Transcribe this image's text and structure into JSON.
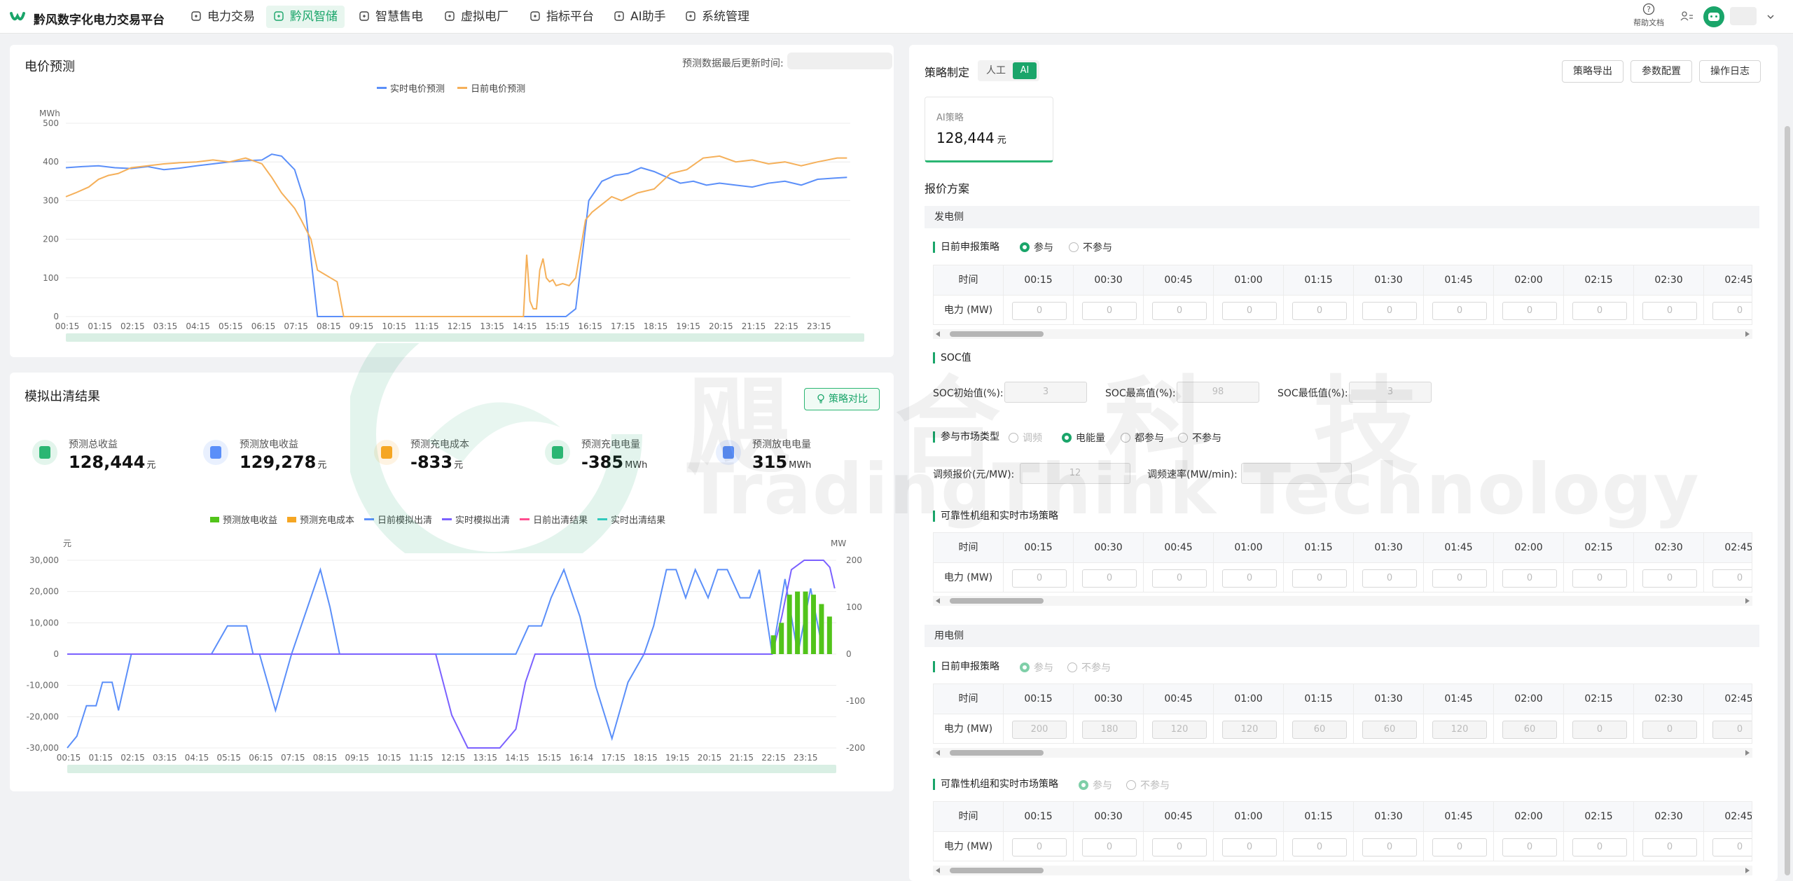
{
  "nav": {
    "brand": "黔风数字化电力交易平台",
    "items": [
      "电力交易",
      "黔风智储",
      "智慧售电",
      "虚拟电厂",
      "指标平台",
      "AI助手",
      "系统管理"
    ],
    "active_index": 1,
    "help_label": "帮助文档"
  },
  "forecast": {
    "title": "电价预测",
    "update_label": "预测数据最后更新时间:",
    "legend": [
      "实时电价预测",
      "日前电价预测"
    ],
    "chart_data": {
      "type": "line",
      "ylabel": "MWh",
      "ylim": [
        0,
        500
      ],
      "yticks": [
        0,
        100,
        200,
        300,
        400,
        500
      ],
      "x_ticks": [
        "00:15",
        "01:15",
        "02:15",
        "03:15",
        "04:15",
        "05:15",
        "06:15",
        "07:15",
        "08:15",
        "09:15",
        "10:15",
        "11:15",
        "12:15",
        "13:15",
        "14:15",
        "15:15",
        "16:15",
        "17:15",
        "18:15",
        "19:15",
        "20:15",
        "21:15",
        "22:15",
        "23:15"
      ],
      "series": [
        {
          "name": "实时电价预测",
          "color": "#5b8ff9",
          "x": [
            0,
            0.5,
            1,
            1.5,
            2,
            2.5,
            3,
            3.5,
            4,
            4.5,
            5,
            5.5,
            6,
            6.3,
            6.6,
            7,
            7.3,
            7.5,
            7.7,
            7.9,
            8.2,
            9,
            10,
            12,
            14,
            14.5,
            15,
            15.3,
            15.6,
            16,
            16.4,
            16.8,
            17.2,
            17.6,
            18,
            18.4,
            18.8,
            19.2,
            19.6,
            20,
            20.5,
            21,
            21.5,
            22,
            22.5,
            23,
            23.5,
            23.9
          ],
          "values": [
            385,
            388,
            390,
            385,
            383,
            388,
            380,
            384,
            390,
            395,
            400,
            403,
            405,
            420,
            415,
            380,
            300,
            150,
            0,
            0,
            0,
            0,
            0,
            0,
            0,
            0,
            0,
            0,
            20,
            300,
            350,
            365,
            370,
            385,
            375,
            360,
            345,
            350,
            340,
            345,
            340,
            335,
            345,
            350,
            340,
            355,
            358,
            360
          ]
        },
        {
          "name": "日前电价预测",
          "color": "#f5b05a",
          "x": [
            0,
            0.3,
            0.7,
            1,
            1.3,
            1.6,
            2,
            2.5,
            3,
            3.5,
            4,
            4.5,
            5,
            5.5,
            6,
            6.3,
            6.6,
            7,
            7.2,
            7.5,
            7.7,
            7.9,
            8.1,
            8.3,
            8.5,
            9,
            10,
            12,
            14,
            14.1,
            14.2,
            14.3,
            14.4,
            14.5,
            14.6,
            14.7,
            14.8,
            14.9,
            15,
            15.2,
            15.4,
            15.6,
            15.9,
            16.1,
            16.4,
            16.7,
            17,
            17.5,
            18,
            18.5,
            19,
            19.5,
            20,
            20.5,
            21,
            21.5,
            22,
            22.5,
            23,
            23.3,
            23.6,
            23.9
          ],
          "values": [
            310,
            320,
            335,
            355,
            365,
            370,
            385,
            390,
            395,
            398,
            400,
            405,
            400,
            410,
            395,
            360,
            320,
            280,
            250,
            200,
            120,
            110,
            100,
            90,
            0,
            0,
            0,
            0,
            0,
            160,
            40,
            20,
            20,
            120,
            150,
            100,
            90,
            95,
            80,
            85,
            80,
            100,
            250,
            270,
            290,
            310,
            300,
            320,
            330,
            370,
            380,
            410,
            415,
            400,
            405,
            395,
            400,
            390,
            400,
            405,
            410,
            410
          ]
        }
      ]
    }
  },
  "clearing": {
    "title": "模拟出清结果",
    "compare_btn": "策略对比",
    "stats": [
      {
        "label": "预测总收益",
        "value": "128,444",
        "unit": "元",
        "color": "#2bb673"
      },
      {
        "label": "预测放电收益",
        "value": "129,278",
        "unit": "元",
        "color": "#5b8ff9"
      },
      {
        "label": "预测充电成本",
        "value": "-833",
        "unit": "元",
        "color": "#f5a623"
      },
      {
        "label": "预测充电电量",
        "value": "-385",
        "unit": "MWh",
        "color": "#2bb673"
      },
      {
        "label": "预测放电电量",
        "value": "315",
        "unit": "MWh",
        "color": "#5b8ff9"
      }
    ],
    "legend": [
      "预测放电收益",
      "预测充电成本",
      "日前模拟出清",
      "实时模拟出清",
      "日前出清结果",
      "实时出清结果"
    ],
    "legend_colors": [
      "#52c41a",
      "#f5a623",
      "#5b8ff9",
      "#7b61ff",
      "#ff4d8f",
      "#36cfc9"
    ],
    "chart_data": {
      "type": "bar-line",
      "ylabel_left": "元",
      "ylabel_right": "MW",
      "ylim_left": [
        -30000,
        30000
      ],
      "ylim_right": [
        -200,
        200
      ],
      "yticks_left": [
        "30,000",
        "20,000",
        "10,000",
        "0",
        "-10,000",
        "-20,000",
        "-30,000"
      ],
      "yticks_right": [
        "200",
        "100",
        "0",
        "-100",
        "-200"
      ],
      "x_ticks": [
        "00:15",
        "01:15",
        "02:15",
        "03:15",
        "04:15",
        "05:15",
        "06:15",
        "07:15",
        "08:15",
        "09:15",
        "10:15",
        "11:15",
        "12:15",
        "13:15",
        "14:15",
        "15:15",
        "16:14",
        "17:15",
        "18:15",
        "19:15",
        "20:15",
        "21:15",
        "22:15",
        "23:15"
      ],
      "series": [
        {
          "name": "日前模拟出清",
          "color": "#5b8ff9",
          "axis": "right",
          "x": [
            0,
            0.3,
            0.6,
            0.9,
            1.1,
            1.4,
            1.6,
            1.8,
            2,
            2.3,
            2.6,
            4.5,
            5,
            5.2,
            5.6,
            5.8,
            6,
            6.5,
            7,
            7.5,
            7.9,
            8.2,
            8.5,
            9,
            10,
            11,
            12,
            13,
            14,
            14.4,
            14.8,
            15.1,
            15.5,
            16,
            16.5,
            17,
            17.5,
            18,
            18.3,
            18.7,
            19,
            19.3,
            19.6,
            20,
            20.3,
            20.6,
            21,
            21.3,
            21.6,
            22,
            22.4,
            22.8,
            23.2,
            23.6
          ],
          "values": [
            -200,
            -175,
            -110,
            -110,
            -60,
            -60,
            -120,
            -60,
            0,
            0,
            0,
            0,
            60,
            60,
            60,
            0,
            0,
            -120,
            0,
            100,
            180,
            100,
            0,
            0,
            0,
            0,
            0,
            0,
            0,
            60,
            60,
            120,
            180,
            80,
            -70,
            -180,
            -60,
            0,
            60,
            180,
            180,
            120,
            180,
            120,
            180,
            180,
            120,
            120,
            180,
            0,
            160,
            0,
            140,
            0
          ]
        },
        {
          "name": "实时模拟出清",
          "color": "#7b61ff",
          "axis": "right",
          "x": [
            0,
            11.5,
            12,
            12.5,
            13,
            13.5,
            14,
            14.3,
            14.6,
            21.5,
            22,
            22.3,
            22.6,
            23,
            23.3,
            23.6,
            23.8,
            23.95
          ],
          "values": [
            0,
            0,
            -130,
            -200,
            -200,
            -200,
            -160,
            -60,
            0,
            0,
            0,
            80,
            180,
            200,
            200,
            200,
            185,
            140
          ]
        },
        {
          "name": "预测放电收益",
          "color": "#52c41a",
          "type": "bar",
          "axis": "left",
          "x": [
            22.05,
            22.3,
            22.55,
            22.8,
            23.05,
            23.3,
            23.55,
            23.8
          ],
          "values": [
            6000,
            10000,
            19000,
            20000,
            20000,
            19000,
            16000,
            12000
          ]
        }
      ]
    }
  },
  "strategy": {
    "title": "策略制定",
    "modes": [
      "人工",
      "AI"
    ],
    "active_mode": 1,
    "buttons": [
      "策略导出",
      "参数配置",
      "操作日志"
    ],
    "card_label": "AI策略",
    "card_value": "128,444",
    "card_unit": "元",
    "plan_title": "报价方案",
    "gen_side": "发电侧",
    "use_side": "用电侧",
    "day_ahead_label": "日前申报策略",
    "opt_join": "参与",
    "opt_nojoin": "不参与",
    "soc_label": "SOC值",
    "soc_fields": [
      {
        "label": "SOC初始值(%):",
        "value": "3"
      },
      {
        "label": "SOC最高值(%):",
        "value": "98"
      },
      {
        "label": "SOC最低值(%):",
        "value": "3"
      }
    ],
    "market_label": "参与市场类型",
    "market_opts": [
      "调频",
      "电能量",
      "都参与",
      "不参与"
    ],
    "reg_price_label": "调频报价(元/MW):",
    "reg_price_value": "12",
    "reg_rate_label": "调频速率(MW/min):",
    "reliable_label": "可靠性机组和实时市场策略",
    "time_header": "时间",
    "power_header": "电力 (MW)",
    "times": [
      "00:15",
      "00:30",
      "00:45",
      "01:00",
      "01:15",
      "01:30",
      "01:45",
      "02:00",
      "02:15",
      "02:30",
      "02:45"
    ],
    "gen_values": [
      "0",
      "0",
      "0",
      "0",
      "0",
      "0",
      "0",
      "0",
      "0",
      "0",
      "0"
    ],
    "rel_values": [
      "0",
      "0",
      "0",
      "0",
      "0",
      "0",
      "0",
      "0",
      "0",
      "0",
      "0"
    ],
    "use_values": [
      "200",
      "180",
      "120",
      "120",
      "60",
      "60",
      "120",
      "60",
      "0",
      "0",
      "0"
    ],
    "use_rel_values": [
      "0",
      "0",
      "0",
      "0",
      "0",
      "0",
      "0",
      "0",
      "0",
      "0",
      "0"
    ]
  },
  "watermark": {
    "text_cn": "飓 合 科 技",
    "text_en": "TradingThink Technology"
  }
}
